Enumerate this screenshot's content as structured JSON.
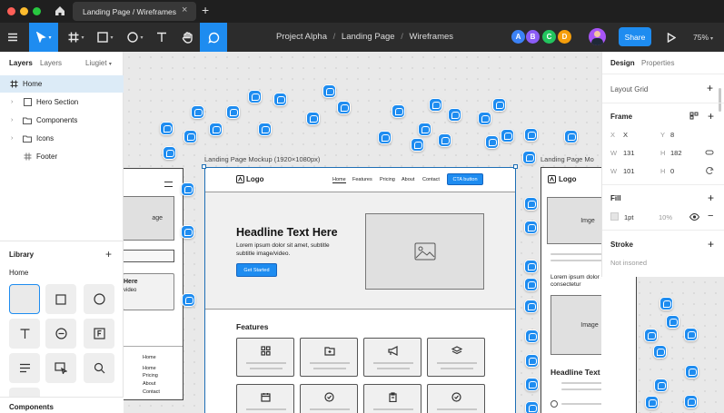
{
  "window": {
    "tab_title": "Landing Page / Wireframes",
    "new_tab": "+",
    "traffic_colors": [
      "#ff5f57",
      "#febc2e",
      "#28c840"
    ]
  },
  "toolbar": {
    "breadcrumb": [
      "Project Alpha",
      "/",
      "Landing Page",
      "/",
      "Wireframes"
    ],
    "collaborators": [
      {
        "initial": "A",
        "color": "#3b82f6"
      },
      {
        "initial": "B",
        "color": "#8b5cf6"
      },
      {
        "initial": "C",
        "color": "#22c55e"
      },
      {
        "initial": "D",
        "color": "#f59e0b"
      }
    ],
    "share_label": "Share",
    "zoom": "75%",
    "accent": "#1e8cf0"
  },
  "left_panel": {
    "tabs": [
      "Layers",
      "Layers"
    ],
    "page_label": "Liugiet",
    "layers": [
      {
        "label": "Home",
        "icon": "frame-icon",
        "selected": true
      },
      {
        "label": "Hero Section",
        "icon": "section-icon"
      },
      {
        "label": "Components",
        "icon": "folder-icon"
      },
      {
        "label": "Icons",
        "icon": "folder-icon"
      },
      {
        "label": "Footer",
        "icon": "grid-icon"
      }
    ],
    "library_title": "Library",
    "library_add": "+",
    "library_group": "Home",
    "components_label": "Components"
  },
  "right_panel": {
    "tabs": [
      "Design",
      "Properties"
    ],
    "layout_grid": "Layout Grid",
    "frame_title": "Frame",
    "x_label": "X",
    "x_value": "X",
    "y_label": "Y",
    "y_value": "8",
    "w_label": "W",
    "w_value": "131",
    "h_label": "H",
    "h_value": "182",
    "w2_label": "W",
    "w2_value": "101",
    "h2_label": "H",
    "h2_value": "0",
    "fill_title": "Fill",
    "fill_value": "1pt",
    "fill_opacity": "10%",
    "stroke_title": "Stroke",
    "stroke_value": "Not insoned"
  },
  "canvas": {
    "main_frame_label": "Landing Page Mockup (1920×1080px)",
    "right_frame_label": "Landing Page Mo",
    "main": {
      "logo": "Logo",
      "nav": [
        "Home",
        "Features",
        "Pricing",
        "About",
        "Contact"
      ],
      "cta": "CTA button",
      "headline": "Headline Text Here",
      "body": "Lorem ipsum dolor sit amet, subtitle subtitle image/video.",
      "button": "Get Started",
      "features_title": "Features",
      "feature_icons": [
        "grid-icon",
        "folder-plus-icon",
        "megaphone-icon",
        "layers-icon",
        "calendar-icon",
        "check-circle-icon",
        "clipboard-icon",
        "check-circle-icon"
      ]
    },
    "left_frame": {
      "image_label": "age",
      "hero_line1": "Here",
      "hero_line2": "video",
      "footer_links": [
        "Home",
        "Home",
        "Pricing",
        "About",
        "Contact"
      ]
    },
    "right_frame": {
      "logo": "Logo",
      "image1": "Imge",
      "body": "Lorem ipsum dolor sit amet, consectetur",
      "image2": "Image",
      "headline": "Headline Text Here"
    }
  }
}
